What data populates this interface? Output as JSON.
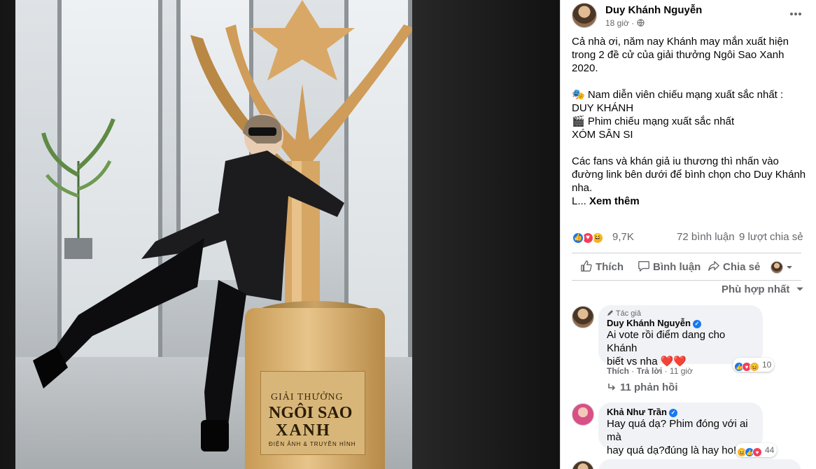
{
  "post": {
    "author": "Duy Khánh Nguyễn",
    "time": "18 giờ",
    "privacy_icon": "globe-icon",
    "paragraphs": [
      "Cả nhà ơi, năm nay Khánh may mắn xuất hiện trong 2 đề cử của giải thưởng Ngôi Sao Xanh 2020.",
      "",
      "🎭 Nam diễn viên chiếu mạng xuất sắc nhất :",
      "DUY KHÁNH",
      "🎬 Phim chiếu mạng xuất sắc nhất",
      "XÓM SÂN SI",
      "",
      "Các fans và khán giả iu thương thì nhấn vào đường link bên dưới để bình chọn cho Duy Khánh nha."
    ],
    "truncation": "L...",
    "see_more": "Xem thêm"
  },
  "reactions": {
    "count": "9,7K",
    "comments": "72 bình luận",
    "shares": "9 lượt chia sẻ"
  },
  "actions": {
    "like": "Thích",
    "comment": "Bình luận",
    "share": "Chia sẻ"
  },
  "sort_label": "Phù hợp nhất",
  "comments": [
    {
      "author_tag": "Tác giả",
      "name": "Duy Khánh Nguyễn",
      "line1": "Ai vote rồi điểm dang cho Khánh",
      "line2": "biết vs nha ❤️❤️",
      "like": "Thích",
      "reply": "Trả lời",
      "time": "11 giờ",
      "reaction_count": "10",
      "replies": "11 phản hồi"
    },
    {
      "name": "Khả Như Trần",
      "line1": "Hay quá dạ? Phim đóng với ai mà",
      "line2": "hay quá dạ?đúng là hay ho!",
      "reaction_count": "44"
    }
  ],
  "photo": {
    "plaque_line1": "GIẢI THƯỞNG",
    "plaque_line2": "NGÔI SAO",
    "plaque_line3": "XANH",
    "plaque_line4": "ĐIỆN ẢNH & TRUYỀN HÌNH"
  },
  "colors": {
    "like_blue": "#1877f2",
    "love_red": "#f33e58",
    "haha_yellow": "#f7b125",
    "text_secondary": "#65676b"
  }
}
